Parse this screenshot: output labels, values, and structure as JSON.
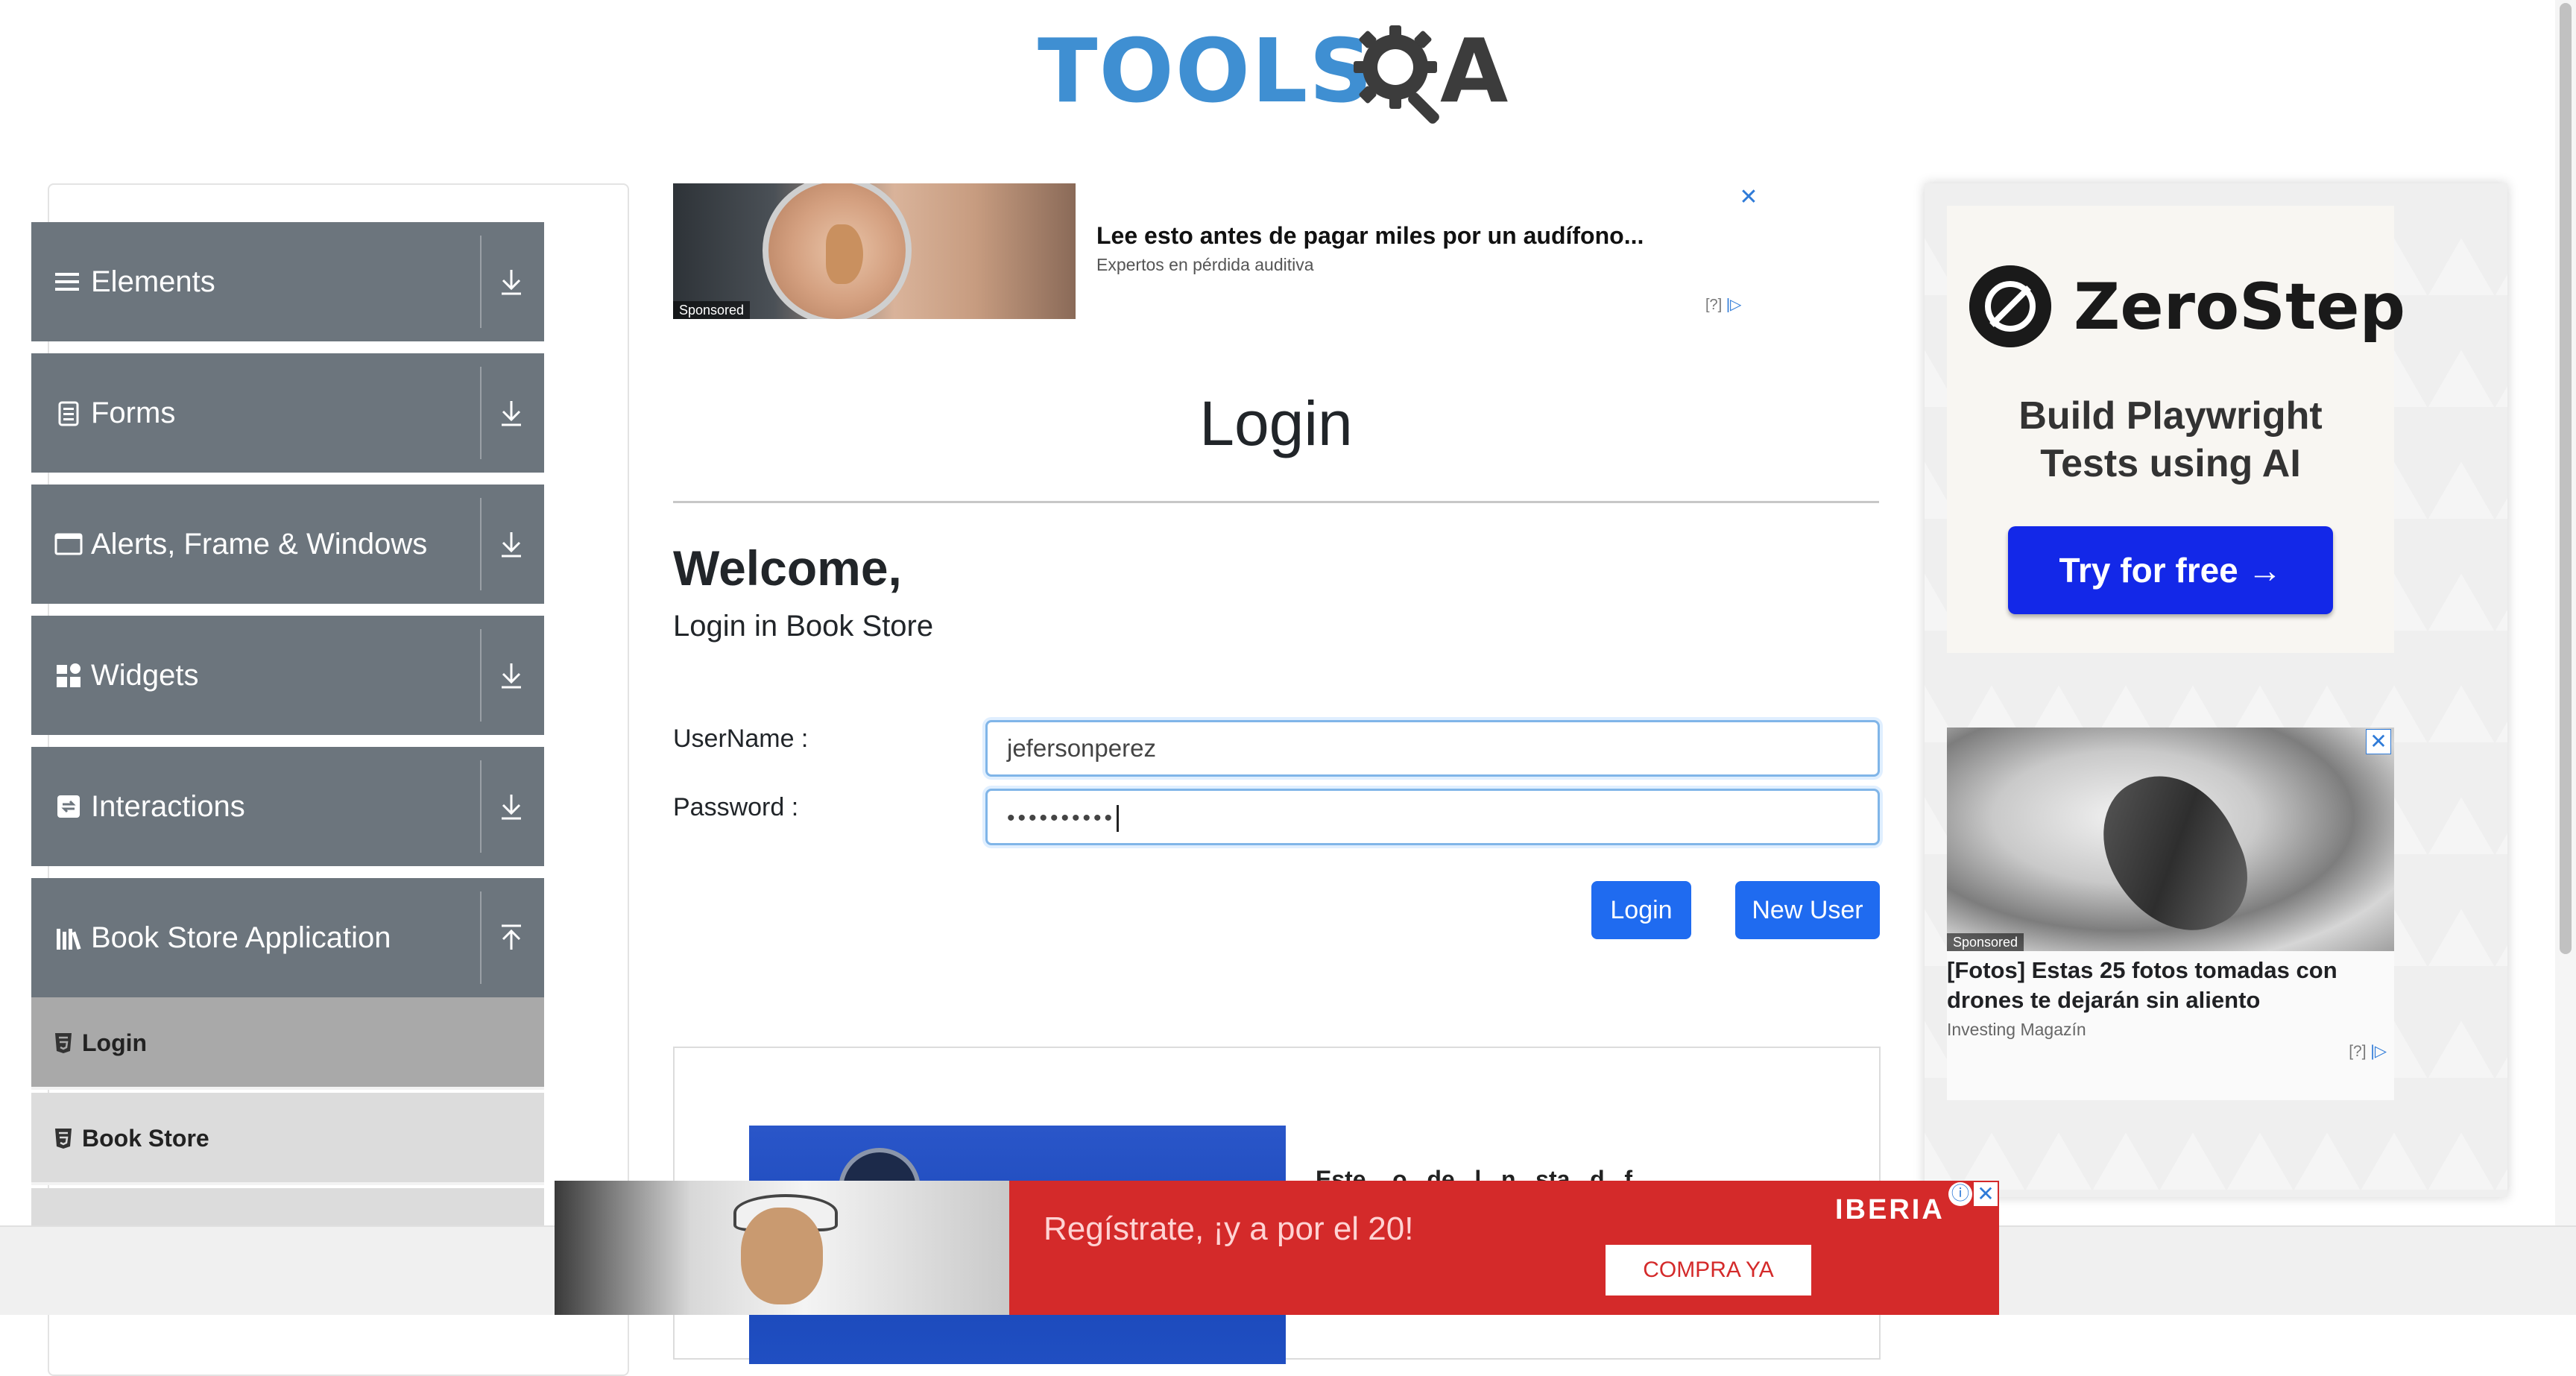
{
  "header": {
    "logo_text": "TOOLS",
    "logo_suffix": "A",
    "logo_alt": "TOOLSQA"
  },
  "sidebar": {
    "groups": [
      {
        "label": "Elements",
        "icon": "hamburger-icon",
        "expanded": false
      },
      {
        "label": "Forms",
        "icon": "document-icon",
        "expanded": false
      },
      {
        "label": "Alerts, Frame & Windows",
        "icon": "window-icon",
        "expanded": false
      },
      {
        "label": "Widgets",
        "icon": "grid-icon",
        "expanded": false
      },
      {
        "label": "Interactions",
        "icon": "interaction-icon",
        "expanded": false
      },
      {
        "label": "Book Store Application",
        "icon": "books-icon",
        "expanded": true
      }
    ],
    "book_store_items": [
      {
        "label": "Login",
        "active": true
      },
      {
        "label": "Book Store",
        "active": false
      }
    ]
  },
  "top_ad": {
    "title": "Lee esto antes de pagar miles por un audífono...",
    "subtitle": "Expertos en pérdida auditiva",
    "sponsored": "Sponsored",
    "info": "[?]"
  },
  "login": {
    "heading": "Login",
    "welcome": "Welcome,",
    "subtitle": "Login in Book Store",
    "username_label": "UserName :",
    "username_value": "jefersonperez",
    "password_label": "Password :",
    "password_value": "••••••••••",
    "login_button": "Login",
    "new_user_button": "New User"
  },
  "lower_ad": {
    "text": "Este ...o...de...l...n...sta...d...f..."
  },
  "right_ad": {
    "brand": "ZeroStep",
    "tagline_line1": "Build Playwright",
    "tagline_line2": "Tests using AI",
    "cta": "Try for free →",
    "drone": {
      "sponsored": "Sponsored",
      "title": "[Fotos] Estas 25 fotos tomadas con drones te dejarán sin aliento",
      "source": "Investing Magazín",
      "info": "[?]"
    }
  },
  "banner": {
    "text": "Regístrate, ¡y a por el 20!",
    "brand": "IBERIA",
    "cta": "COMPRA YA"
  },
  "colors": {
    "accent_blue": "#1f6bf0",
    "sidebar_gray": "#6c757d",
    "zerostep_blue": "#1328e8",
    "iberia_red": "#d42a2a"
  }
}
